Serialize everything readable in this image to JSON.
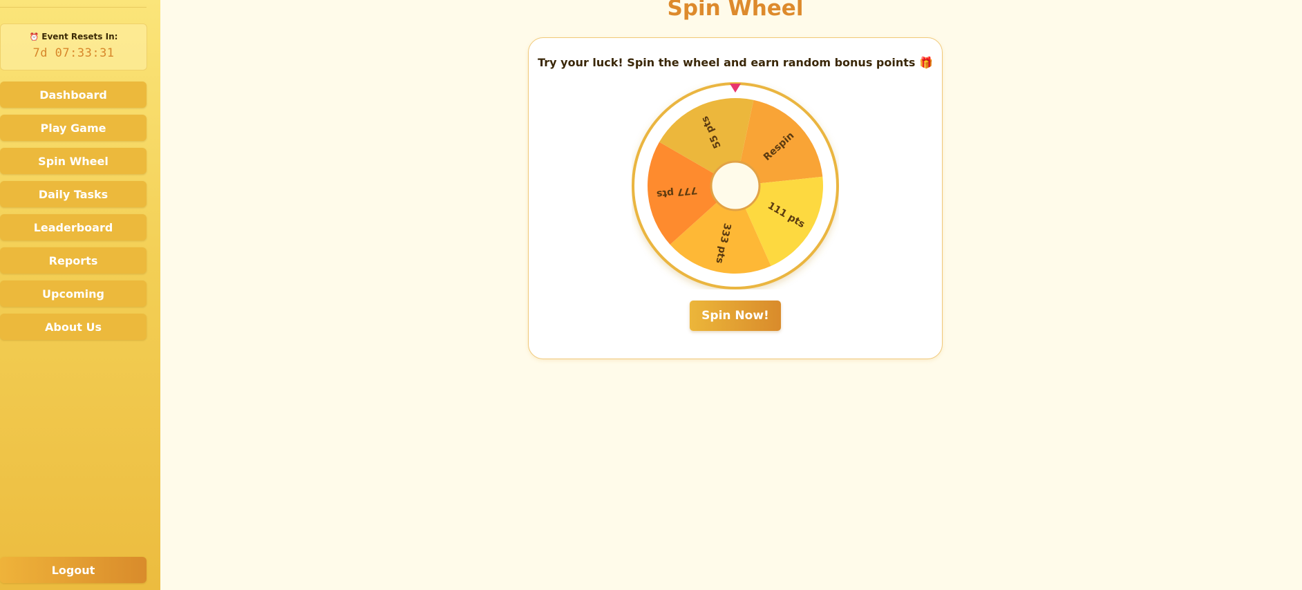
{
  "sidebar": {
    "timer_label": "Event Resets In:",
    "timer_value": "7d 07:33:31",
    "timer_icon": "alarm-clock-icon",
    "items": [
      {
        "label": "Dashboard"
      },
      {
        "label": "Play Game"
      },
      {
        "label": "Spin Wheel"
      },
      {
        "label": "Daily Tasks"
      },
      {
        "label": "Leaderboard"
      },
      {
        "label": "Reports"
      },
      {
        "label": "Upcoming"
      },
      {
        "label": "About Us"
      }
    ],
    "logout_label": "Logout"
  },
  "main": {
    "title": "Spin Wheel",
    "tagline": "Try your luck! Spin the wheel and earn random bonus points 🎁",
    "spin_button": "Spin Now!"
  },
  "wheel": {
    "segments": [
      {
        "label": "Respin",
        "color": "#f9a436"
      },
      {
        "label": "111 pts",
        "color": "#fdd940"
      },
      {
        "label": "333 pts",
        "color": "#feb836"
      },
      {
        "label": "777 pts",
        "color": "#fe8b2e"
      },
      {
        "label": "55 pts",
        "color": "#ecb73c"
      }
    ],
    "rim_color": "#eab53f",
    "pointer_color": "#e8356d"
  },
  "colors": {
    "accent": "#dd8a2c",
    "sidebar_button": "#ecb93c",
    "background": "#fffbea"
  }
}
